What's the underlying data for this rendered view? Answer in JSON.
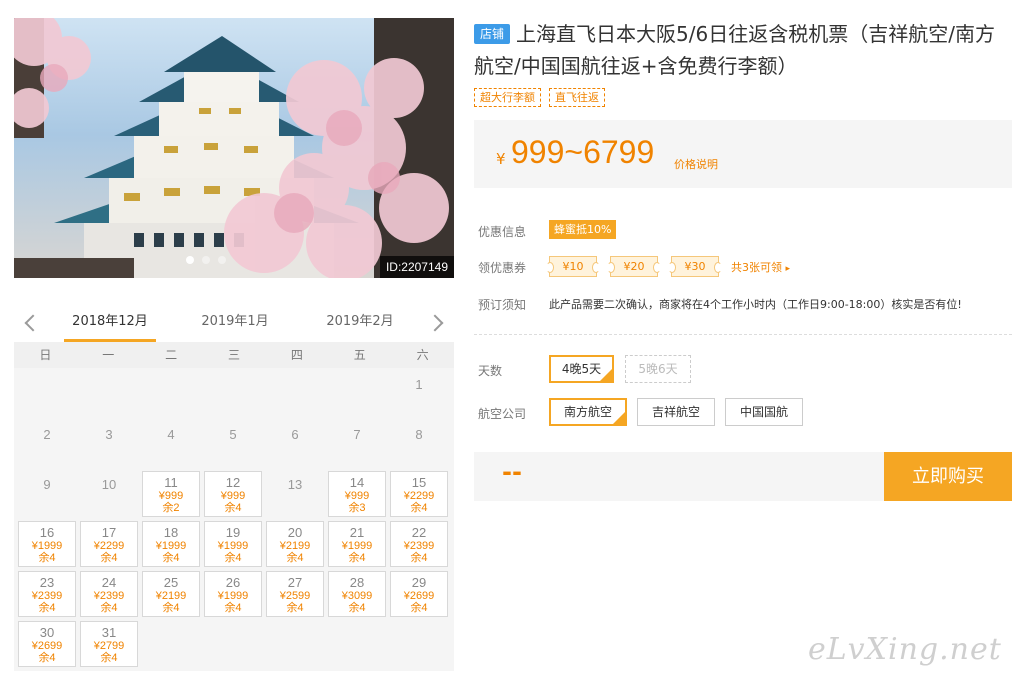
{
  "hero": {
    "image_id": "ID:2207149"
  },
  "calendar": {
    "months": [
      "2018年12月",
      "2019年1月",
      "2019年2月"
    ],
    "weekdays": [
      "日",
      "一",
      "二",
      "三",
      "四",
      "五",
      "六"
    ],
    "days": [
      {
        "d": "1"
      },
      {
        "d": "2"
      },
      {
        "d": "3"
      },
      {
        "d": "4"
      },
      {
        "d": "5"
      },
      {
        "d": "6"
      },
      {
        "d": "7"
      },
      {
        "d": "8"
      },
      {
        "d": "9"
      },
      {
        "d": "10"
      },
      {
        "d": "11",
        "p": "¥999",
        "r": "余2"
      },
      {
        "d": "12",
        "p": "¥999",
        "r": "余4"
      },
      {
        "d": "13"
      },
      {
        "d": "14",
        "p": "¥999",
        "r": "余3"
      },
      {
        "d": "15",
        "p": "¥2299",
        "r": "余4"
      },
      {
        "d": "16",
        "p": "¥1999",
        "r": "余4"
      },
      {
        "d": "17",
        "p": "¥2299",
        "r": "余4"
      },
      {
        "d": "18",
        "p": "¥1999",
        "r": "余4"
      },
      {
        "d": "19",
        "p": "¥1999",
        "r": "余4"
      },
      {
        "d": "20",
        "p": "¥2199",
        "r": "余4"
      },
      {
        "d": "21",
        "p": "¥1999",
        "r": "余4"
      },
      {
        "d": "22",
        "p": "¥2399",
        "r": "余4"
      },
      {
        "d": "23",
        "p": "¥2399",
        "r": "余4"
      },
      {
        "d": "24",
        "p": "¥2399",
        "r": "余4"
      },
      {
        "d": "25",
        "p": "¥2199",
        "r": "余4"
      },
      {
        "d": "26",
        "p": "¥1999",
        "r": "余4"
      },
      {
        "d": "27",
        "p": "¥2599",
        "r": "余4"
      },
      {
        "d": "28",
        "p": "¥3099",
        "r": "余4"
      },
      {
        "d": "29",
        "p": "¥2699",
        "r": "余4"
      },
      {
        "d": "30",
        "p": "¥2699",
        "r": "余4"
      },
      {
        "d": "31",
        "p": "¥2799",
        "r": "余4"
      }
    ]
  },
  "product": {
    "shop_badge": "店铺",
    "title": "上海直飞日本大阪5/6日往返含税机票（吉祥航空/南方航空/中国国航往返+含免费行李额）",
    "tags": [
      "超大行李额",
      "直飞往返"
    ],
    "price_currency": "¥",
    "price_range": "999~6799",
    "price_note": "价格说明"
  },
  "info": {
    "promo_label": "优惠信息",
    "promo_badge": "蜂蜜抵10%",
    "coupon_label": "领优惠券",
    "coupons": [
      "¥10",
      "¥20",
      "¥30"
    ],
    "coupon_more": "共3张可领",
    "notice_label": "预订须知",
    "notice_text": "此产品需要二次确认，商家将在4个工作小时内（工作日9:00-18:00）核实是否有位!"
  },
  "options": {
    "days_label": "天数",
    "days": [
      "4晚5天",
      "5晚6天"
    ],
    "airline_label": "航空公司",
    "airlines": [
      "南方航空",
      "吉祥航空",
      "中国国航"
    ]
  },
  "buy": {
    "total": "--",
    "button": "立即购买"
  },
  "watermark": "eLvXing.net",
  "colors": {
    "accent": "#f5a623",
    "price": "#f08300",
    "shop_badge": "#3c9be8"
  }
}
